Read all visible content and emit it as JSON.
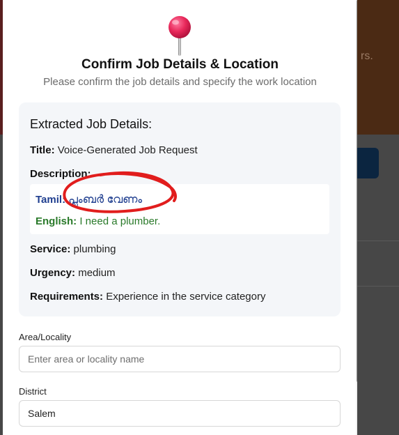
{
  "modal": {
    "title": "Confirm Job Details & Location",
    "subtitle": "Please confirm the job details and specify the work location"
  },
  "details": {
    "heading": "Extracted Job Details:",
    "title_label": "Title:",
    "title_value": "Voice-Generated Job Request",
    "description_label": "Description:",
    "tamil_label": "Tamil:",
    "tamil_value": "പ്ലംബർ വേണം",
    "english_label": "English:",
    "english_value": "I need a plumber.",
    "service_label": "Service:",
    "service_value": "plumbing",
    "urgency_label": "Urgency:",
    "urgency_value": "medium",
    "requirements_label": "Requirements:",
    "requirements_value": "Experience in the service category"
  },
  "form": {
    "area_label": "Area/Locality",
    "area_placeholder": "Enter area or locality name",
    "area_value": "",
    "district_label": "District",
    "district_value": "Salem"
  },
  "background": {
    "hero_text_fragment": "rs."
  },
  "colors": {
    "tamil_text": "#1f3e8f",
    "english_text": "#2a7a2a",
    "annotation": "#e11d1d",
    "card_bg": "#f4f6f9"
  },
  "icons": {
    "header_icon": "pushpin-icon"
  }
}
